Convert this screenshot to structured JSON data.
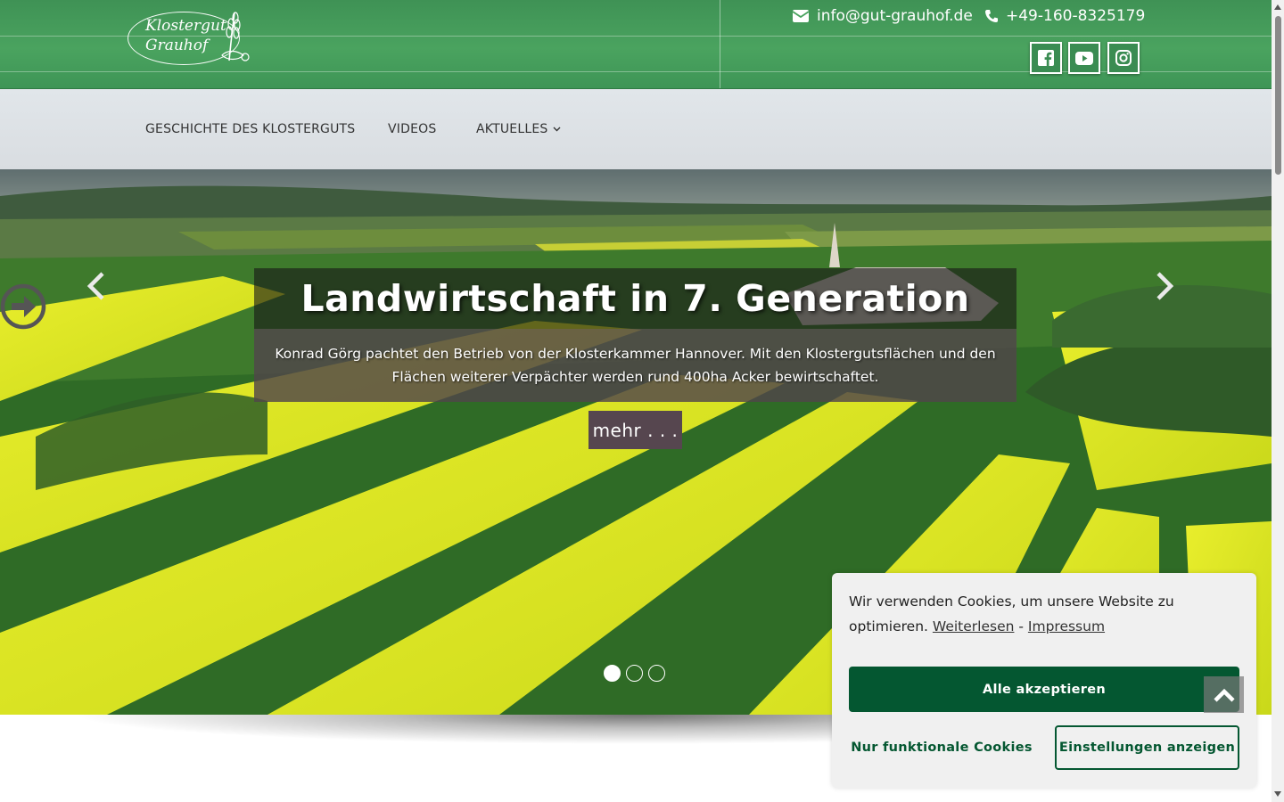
{
  "header": {
    "logo": {
      "line1": "Klostergut",
      "line2": "Grauhof"
    },
    "email": "info@gut-grauhof.de",
    "phone": "+49-160-8325179",
    "social": [
      {
        "name": "facebook-icon"
      },
      {
        "name": "youtube-icon"
      },
      {
        "name": "instagram-icon"
      }
    ]
  },
  "nav": {
    "items": [
      {
        "label": "GESCHICHTE DES KLOSTERGUTS"
      },
      {
        "label": "VIDEOS"
      },
      {
        "label": "AKTUELLES",
        "has_dropdown": true
      }
    ]
  },
  "hero": {
    "title": "Landwirtschaft in 7. Generation",
    "text": "Konrad Görg pachtet den Betrieb von der Klosterkammer Hannover. Mit den Klostergutsflächen und den Flächen weiterer Verpächter werden rund 400ha Acker bewirtschaftet.",
    "more_label": "mehr . . .",
    "slides_total": 3,
    "active_slide": 1
  },
  "cookie": {
    "message": "Wir verwenden Cookies, um unsere Website zu optimieren.",
    "link_read_more": "Weiterlesen",
    "separator": "-",
    "link_imprint": "Impressum",
    "accept_all": "Alle akzeptieren",
    "functional_only": "Nur funktionale Cookies",
    "show_settings": "Einstellungen anzeigen"
  },
  "colors": {
    "header_green": "#4aa35f",
    "cookie_green": "#045731",
    "caption_button": "#56464f"
  }
}
